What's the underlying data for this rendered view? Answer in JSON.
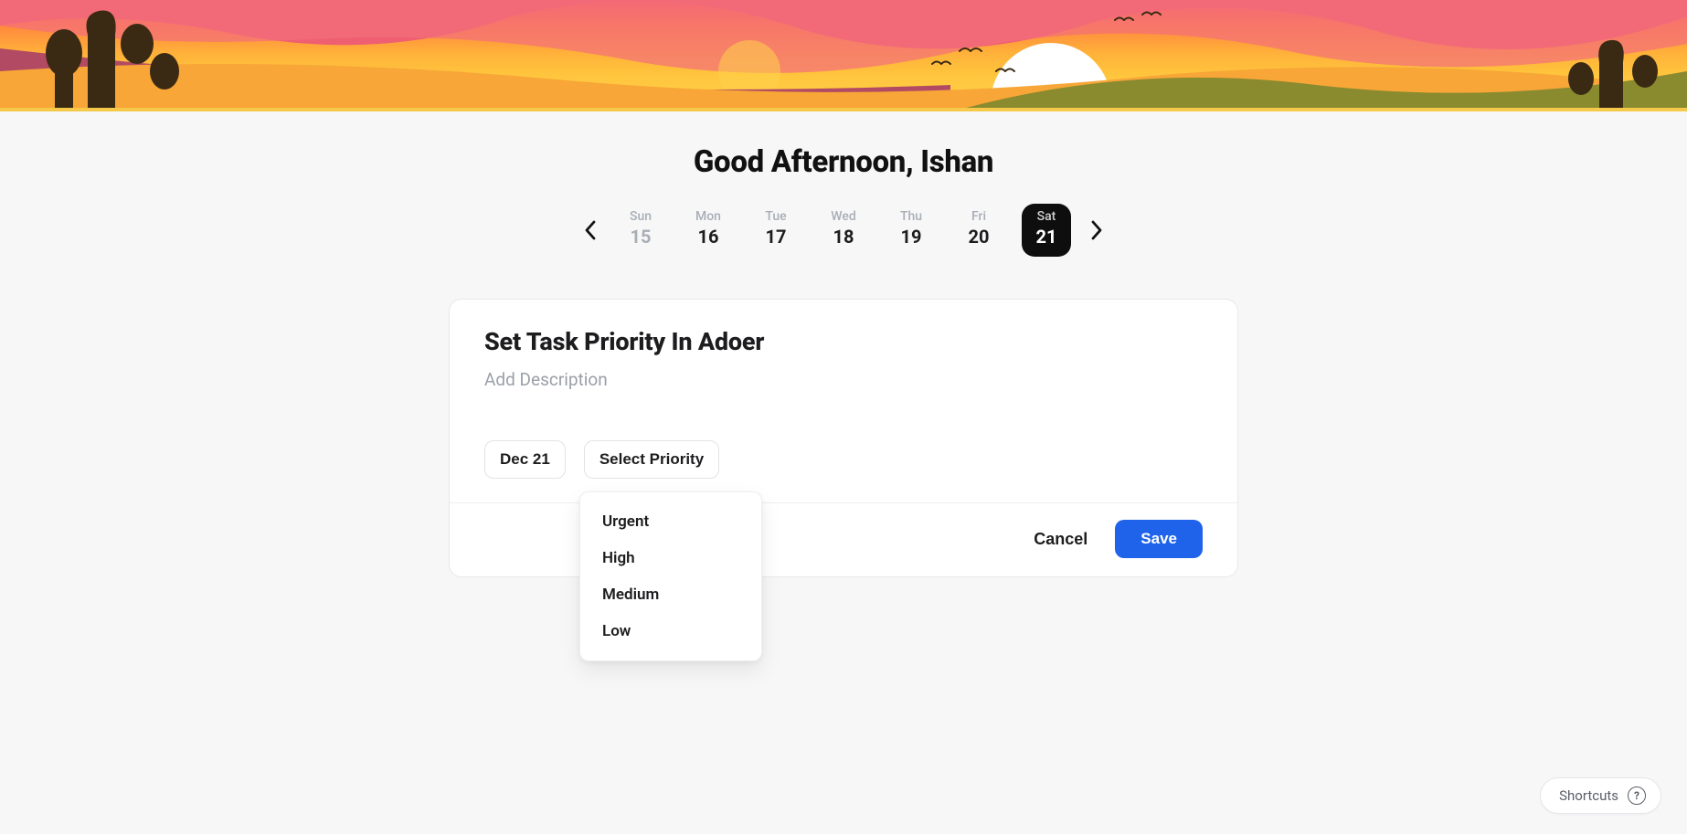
{
  "greeting": "Good Afternoon, Ishan",
  "dates": {
    "items": [
      {
        "dow": "Sun",
        "num": "15",
        "state": "faded"
      },
      {
        "dow": "Mon",
        "num": "16",
        "state": ""
      },
      {
        "dow": "Tue",
        "num": "17",
        "state": ""
      },
      {
        "dow": "Wed",
        "num": "18",
        "state": ""
      },
      {
        "dow": "Thu",
        "num": "19",
        "state": ""
      },
      {
        "dow": "Fri",
        "num": "20",
        "state": ""
      },
      {
        "dow": "Sat",
        "num": "21",
        "state": "active"
      }
    ]
  },
  "task": {
    "title": "Set Task Priority In Adoer",
    "description_placeholder": "Add Description",
    "chips": {
      "date_label": "Dec 21",
      "priority_label": "Select Priority"
    },
    "priority_options": {
      "0": "Urgent",
      "1": "High",
      "2": "Medium",
      "3": "Low"
    },
    "actions": {
      "cancel": "Cancel",
      "save": "Save"
    }
  },
  "shortcuts": {
    "label": "Shortcuts"
  }
}
